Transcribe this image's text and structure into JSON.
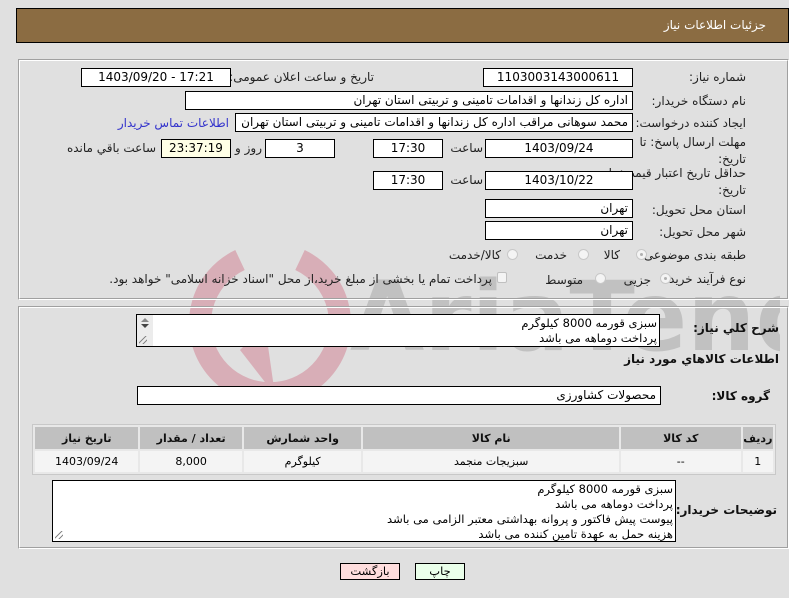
{
  "header": {
    "title": "جزئیات اطلاعات نیاز"
  },
  "form": {
    "need_number": {
      "label": "شماره نیاز:",
      "value": "1103003143000611"
    },
    "announce_datetime": {
      "label": "تاریخ و ساعت اعلان عمومی:",
      "value": "1403/09/20 - 17:21"
    },
    "buyer_org": {
      "label": "نام دستگاه خریدار:",
      "value": "اداره کل زندانها و اقدامات تامینی و تربیتی استان تهران"
    },
    "requester": {
      "label": "ایجاد کننده درخواست:",
      "value": "محمد سوهانی مراقب  اداره کل زندانها و اقدامات تامینی و تربیتی استان تهران",
      "contact_link": "اطلاعات تماس خریدار"
    },
    "reply_deadline": {
      "label_line1": "مهلت ارسال پاسخ: تا",
      "label_line2": "تاریخ:",
      "date": "1403/09/24",
      "time_label": "ساعت",
      "time": "17:30",
      "days": "3",
      "days_label": "روز و",
      "remaining": "23:37:19",
      "remaining_label": "ساعت باقي مانده"
    },
    "price_validity": {
      "label_line1": "حداقل تاریخ اعتبار قیمت: تا",
      "label_line2": "تاریخ:",
      "date": "1403/10/22",
      "time_label": "ساعت",
      "time": "17:30"
    },
    "delivery_province": {
      "label": "استان محل تحویل:",
      "value": "تهران"
    },
    "delivery_city": {
      "label": "شهر محل تحویل:",
      "value": "تهران"
    },
    "category": {
      "label": "طبقه بندی موضوعی:",
      "options": [
        "کالا",
        "خدمت",
        "کالا/خدمت"
      ],
      "selected": "کالا"
    },
    "purchase_type": {
      "label": "نوع فرآیند خرید :",
      "options": [
        "جزیی",
        "متوسط"
      ],
      "selected": "جزیی",
      "treasury_checkbox_label": "پرداخت تمام یا بخشی از مبلغ خرید،از محل \"اسناد خزانه اسلامی\" خواهد بود.",
      "treasury_checked": false
    }
  },
  "details": {
    "general_desc_label": "شرح کلي نیاز:",
    "general_desc_lines": [
      "سبزی قورمه 8000 کیلوگرم",
      "پرداخت دوماهه می باشد"
    ],
    "goods_section_title": "اطلاعات کالاهاي مورد نیاز",
    "goods_group_label": "گروه کالا:",
    "goods_group_value": "محصولات کشاورزی",
    "table": {
      "headers": [
        "ردیف",
        "کد کالا",
        "نام کالا",
        "واحد شمارش",
        "تعداد / مقدار",
        "تاریخ نیاز"
      ],
      "rows": [
        [
          "1",
          "--",
          "سبزیجات منجمد",
          "کیلوگرم",
          "8,000",
          "1403/09/24"
        ]
      ]
    },
    "buyer_notes_label": "توضیحات خریدار:",
    "buyer_notes_lines": [
      "سبزی قورمه 8000 کیلوگرم",
      "پرداخت دوماهه می باشد",
      "پیوست پیش فاکتور و پروانه بهداشتی معتبر الزامی می باشد",
      "هزینه حمل به عهدة تامین کننده می باشد"
    ]
  },
  "buttons": {
    "print": "چاپ",
    "back": "بازگشت"
  },
  "colors": {
    "header_bg": "#8b6c42",
    "link": "#3333cc",
    "print_bg": "#eaffea",
    "back_bg": "#ffdede"
  }
}
